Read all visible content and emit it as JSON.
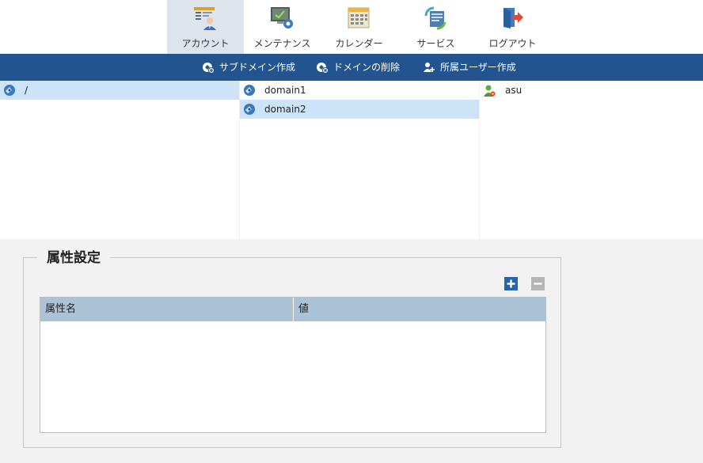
{
  "nav": {
    "items": [
      {
        "label": "アカウント",
        "icon": "account-icon",
        "active": true
      },
      {
        "label": "メンテナンス",
        "icon": "maintenance-icon",
        "active": false
      },
      {
        "label": "カレンダー",
        "icon": "calendar-icon",
        "active": false
      },
      {
        "label": "サービス",
        "icon": "service-icon",
        "active": false
      },
      {
        "label": "ログアウト",
        "icon": "logout-icon",
        "active": false
      }
    ]
  },
  "actions": {
    "items": [
      {
        "label": "サブドメイン作成",
        "icon": "add-subdomain-icon"
      },
      {
        "label": "ドメインの削除",
        "icon": "delete-domain-icon"
      },
      {
        "label": "所属ユーザー作成",
        "icon": "add-user-icon"
      }
    ]
  },
  "tree": {
    "root": [
      {
        "label": "/",
        "icon": "domain-icon",
        "selected": true
      }
    ],
    "domains": [
      {
        "label": "domain1",
        "icon": "domain-icon",
        "selected": false
      },
      {
        "label": "domain2",
        "icon": "domain-icon",
        "selected": true
      }
    ],
    "users": [
      {
        "label": "asu",
        "icon": "user-icon",
        "selected": false
      }
    ]
  },
  "attributes": {
    "title": "属性設定",
    "add_icon": "plus-icon",
    "remove_icon": "minus-icon",
    "columns": [
      "属性名",
      "値"
    ],
    "rows": []
  },
  "colors": {
    "accent": "#22558f",
    "selection": "#cde3f8",
    "table_header": "#acc2d7"
  }
}
